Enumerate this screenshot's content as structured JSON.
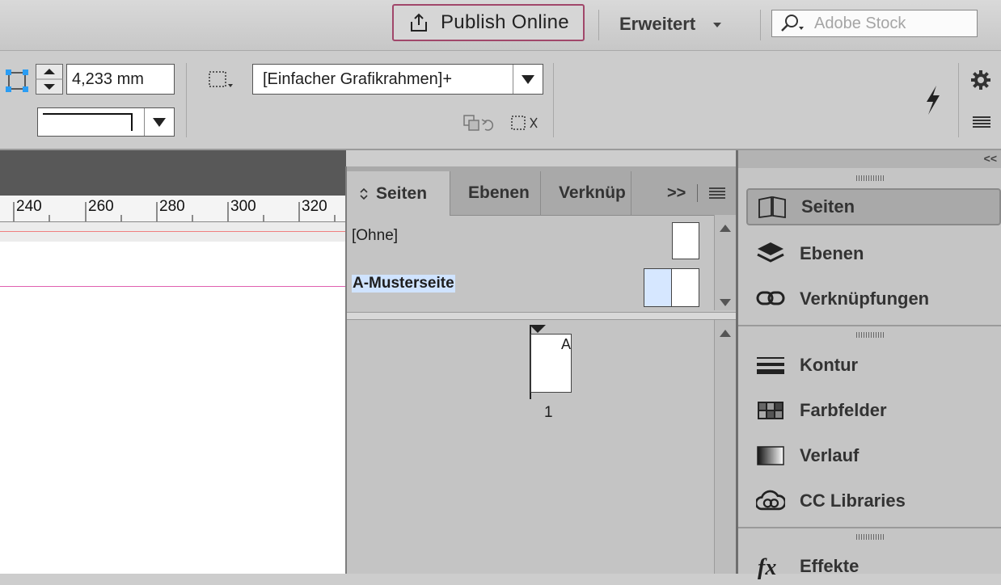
{
  "topbar": {
    "publish_label": "Publish Online",
    "workspace_label": "Erweitert",
    "search_placeholder": "Adobe Stock"
  },
  "controlbar": {
    "stroke_weight": "4,233 mm",
    "object_style": "[Einfacher Grafikrahmen]+"
  },
  "ruler": {
    "labels": [
      "240",
      "260",
      "280",
      "300",
      "320"
    ]
  },
  "pages_panel": {
    "tabs": [
      {
        "label": "Seiten"
      },
      {
        "label": "Ebenen"
      },
      {
        "label": "Verknüp"
      }
    ],
    "overflow_label": ">>",
    "masters": [
      {
        "label": "[Ohne]"
      },
      {
        "label": "A-Musterseite"
      }
    ],
    "page_master_letter": "A",
    "page_number": "1"
  },
  "dock": {
    "collapse_label": "<<",
    "groups": [
      {
        "items": [
          {
            "label": "Seiten",
            "icon": "pages-icon"
          },
          {
            "label": "Ebenen",
            "icon": "layers-icon"
          },
          {
            "label": "Verknüpfungen",
            "icon": "links-icon"
          }
        ]
      },
      {
        "items": [
          {
            "label": "Kontur",
            "icon": "stroke-icon"
          },
          {
            "label": "Farbfelder",
            "icon": "swatches-icon"
          },
          {
            "label": "Verlauf",
            "icon": "gradient-icon"
          },
          {
            "label": "CC Libraries",
            "icon": "cc-libraries-icon"
          }
        ]
      },
      {
        "items": [
          {
            "label": "Effekte",
            "icon": "fx-icon"
          }
        ]
      }
    ]
  },
  "colors": {
    "publish_border": "#a1476a",
    "selection_blue": "#cfe3ff",
    "guide_magenta": "#e060b0"
  }
}
